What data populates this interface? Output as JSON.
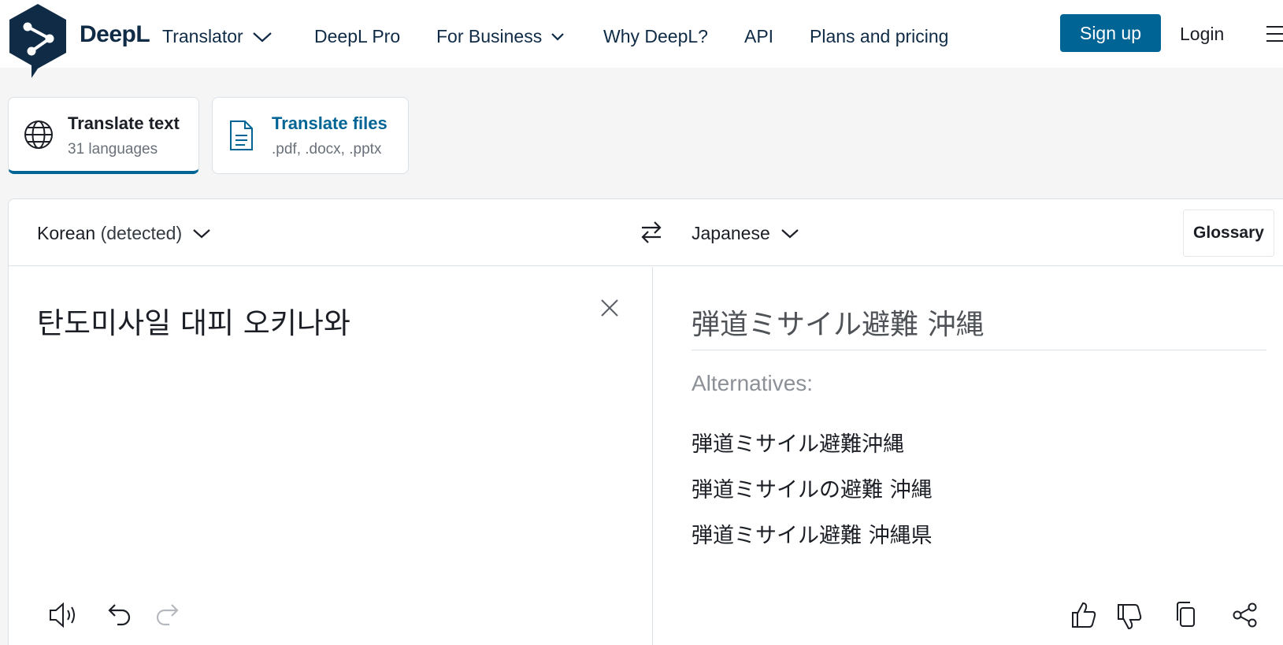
{
  "header": {
    "brand": "DeepL",
    "product": "Translator",
    "nav": {
      "pro": "DeepL Pro",
      "business": "For Business",
      "why": "Why DeepL?",
      "api": "API",
      "pricing": "Plans and pricing"
    },
    "signup": "Sign up",
    "login": "Login"
  },
  "tabs": [
    {
      "title": "Translate text",
      "subtitle": "31 languages"
    },
    {
      "title": "Translate files",
      "subtitle": ".pdf, .docx, .pptx"
    }
  ],
  "source": {
    "language": "Korean",
    "detected_suffix": "(detected)",
    "text": "탄도미사일 대피 오키나와"
  },
  "target": {
    "language": "Japanese",
    "text": "弾道ミサイル避難 沖縄",
    "alternatives_label": "Alternatives:",
    "alternatives": [
      "弾道ミサイル避難沖縄",
      "弾道ミサイルの避難 沖縄",
      "弾道ミサイル避難 沖縄県"
    ]
  },
  "glossary": "Glossary",
  "colors": {
    "brand_dark": "#0f2b46",
    "accent": "#006494",
    "background": "#f5f5f5"
  }
}
